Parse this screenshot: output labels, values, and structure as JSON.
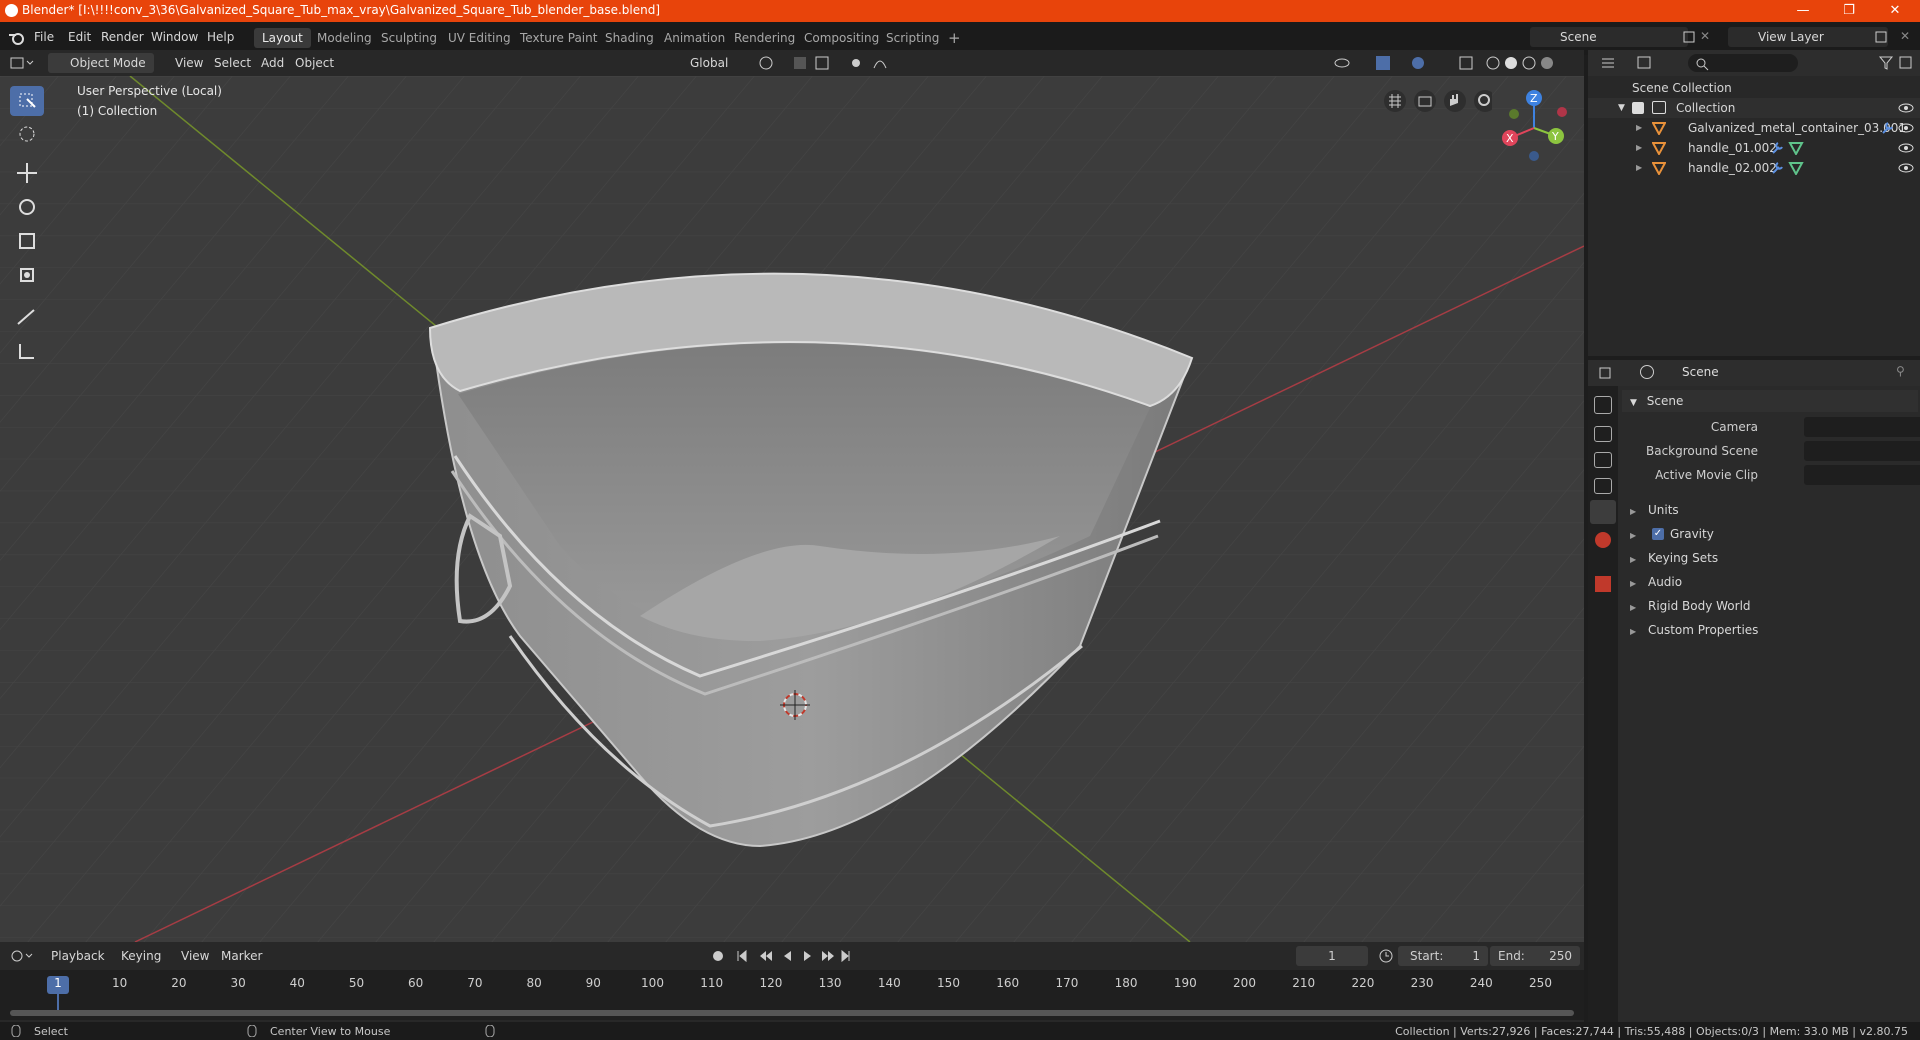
{
  "window": {
    "title": "Blender* [I:\\!!!!conv_3\\36\\Galvanized_Square_Tub_max_vray\\Galvanized_Square_Tub_blender_base.blend]",
    "minimize": "—",
    "maximize": "❐",
    "close": "✕"
  },
  "menu": {
    "items": [
      "File",
      "Edit",
      "Render",
      "Window",
      "Help"
    ],
    "workspaces": [
      "Layout",
      "Modeling",
      "Sculpting",
      "UV Editing",
      "Texture Paint",
      "Shading",
      "Animation",
      "Rendering",
      "Compositing",
      "Scripting"
    ],
    "active_workspace": "Layout",
    "add_tab": "+",
    "scene": "Scene",
    "view_layer": "View Layer"
  },
  "viewport_header": {
    "mode": "Object Mode",
    "menus": [
      "View",
      "Select",
      "Add",
      "Object"
    ],
    "orientation": "Global"
  },
  "viewport": {
    "perspective": "User Perspective (Local)",
    "collection": "(1) Collection",
    "gizmo": {
      "x": "X",
      "y": "Y",
      "z": "Z"
    }
  },
  "outliner": {
    "root": "Scene Collection",
    "collection": "Collection",
    "objects": [
      "Galvanized_metal_container_03.001",
      "handle_01.002",
      "handle_02.002"
    ]
  },
  "properties": {
    "header": "Scene",
    "panel": "Scene",
    "fields": [
      {
        "label": "Camera",
        "value": ""
      },
      {
        "label": "Background Scene",
        "value": ""
      },
      {
        "label": "Active Movie Clip",
        "value": ""
      }
    ],
    "sections": [
      "Units",
      "Gravity",
      "Keying Sets",
      "Audio",
      "Rigid Body World",
      "Custom Properties"
    ],
    "gravity_checked": true
  },
  "timeline": {
    "menus": [
      "Playback",
      "Keying",
      "View",
      "Marker"
    ],
    "current_frame": "1",
    "start_label": "Start:",
    "start": "1",
    "end_label": "End:",
    "end": "250",
    "ruler": [
      "1",
      "10",
      "20",
      "30",
      "40",
      "50",
      "60",
      "70",
      "80",
      "90",
      "100",
      "110",
      "120",
      "130",
      "140",
      "150",
      "160",
      "170",
      "180",
      "190",
      "200",
      "210",
      "220",
      "230",
      "240",
      "250"
    ]
  },
  "status": {
    "select": "Select",
    "center_view": "Center View to Mouse",
    "stats": "Collection | Verts:27,926 | Faces:27,744 | Tris:55,488 | Objects:0/3 | Mem: 33.0 MB | v2.80.75"
  },
  "colors": {
    "title_bar": "#e8440b",
    "active_tool": "#4d6ea8",
    "axis_x": "#e0455b",
    "axis_y": "#8cc43f",
    "axis_z": "#3e82e0"
  }
}
